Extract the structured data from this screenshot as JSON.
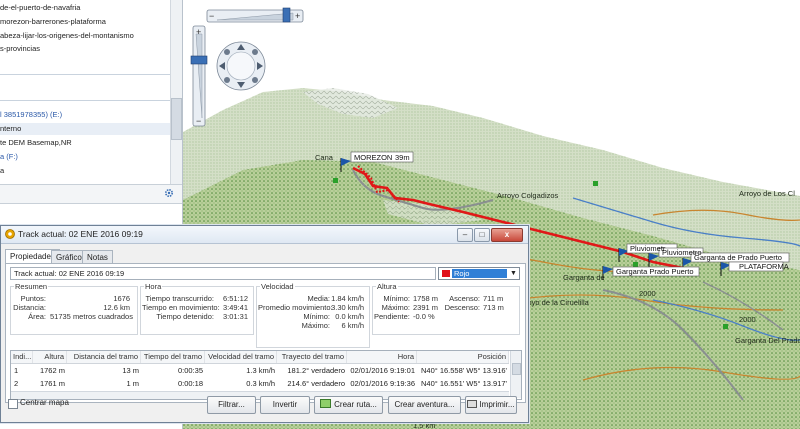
{
  "left_panel": {
    "items": [
      {
        "label": "de-el-puerto-de-navafria"
      },
      {
        "label": "morezon-barrerones-plataforma"
      },
      {
        "label": "abeza-lijar-los-origenes-del-montanismo"
      },
      {
        "label": "s-provincias"
      },
      {
        "label": "l 3851978355) (E:)"
      },
      {
        "label": "nterno"
      },
      {
        "label": "te DEM Basemap,NR"
      },
      {
        "label": "a (F:)"
      },
      {
        "label": "a"
      }
    ]
  },
  "map": {
    "labels": {
      "morezon": "MOREZON",
      "cana_prefix": "Cana",
      "morezon_height": "39m",
      "arroyo_colgadizos": "Arroyo Colgadizos",
      "arroyo_de_los": "Arroyo de Los Cl",
      "pluviometro1": "Pluviometr",
      "pluviometro2": "Pluviometro",
      "garganta_prado_puerto": "Garganta Prado Puerto",
      "garganta_de_prado_puerto": "Garganta de Prado Puerto",
      "plataforma": "PLATAFORMA",
      "garganta_de": "Garganta de",
      "arroyo_ciruelilla": "royo de la Ciruelilla",
      "garganta_del_prado": "Garganta Del Prado P",
      "contour_2000a": "2000",
      "contour_2000b": "2000",
      "bottom_fragment": "1,5 km"
    }
  },
  "dialog": {
    "title": "Track actual: 02 ENE 2016 09:19",
    "tabs": [
      "Propiedades",
      "Gráfico",
      "Notas"
    ],
    "name_value": "Track actual: 02 ENE 2016 09:19",
    "color_label": "Rojo",
    "colors": {
      "swatch": "#e0101a",
      "selection": "#2f7fd6"
    },
    "resumen": {
      "title": "Resumen",
      "rows": [
        {
          "label": "Puntos:",
          "value": "1676"
        },
        {
          "label": "Distancia:",
          "value": "12.6 km"
        },
        {
          "label": "Área:",
          "value": "51735 metros cuadrados"
        }
      ]
    },
    "hora": {
      "title": "Hora",
      "rows": [
        {
          "label": "Tiempo transcurrido:",
          "value": "6:51:12"
        },
        {
          "label": "Tiempo en movimiento:",
          "value": "3:49:41"
        },
        {
          "label": "Tiempo detenido:",
          "value": "3:01:31"
        }
      ]
    },
    "velocidad": {
      "title": "Velocidad",
      "rows": [
        {
          "label": "Media:",
          "value": "1.84 km/h"
        },
        {
          "label": "Promedio movimiento:",
          "value": "3.30 km/h"
        },
        {
          "label": "Mínimo:",
          "value": "0.0 km/h"
        },
        {
          "label": "Máximo:",
          "value": "6 km/h"
        }
      ]
    },
    "altura": {
      "title": "Altura",
      "min_label": "Mínimo:",
      "min_value": "1758 m",
      "max_label": "Máximo:",
      "max_value": "2391 m",
      "asc_label": "Ascenso:",
      "asc_value": "711 m",
      "desc_label": "Descenso:",
      "desc_value": "713 m",
      "slope_label": "Pendiente:",
      "slope_value": "-0.0 %"
    },
    "table": {
      "headers": [
        "Indi...",
        "Altura",
        "Distancia del tramo",
        "Tiempo del tramo",
        "Velocidad del tramo",
        "Trayecto del tramo",
        "Hora",
        "Posición"
      ],
      "rows": [
        [
          "1",
          "1762 m",
          "13 m",
          "0:00:35",
          "1.3 km/h",
          "181.2° verdadero",
          "02/01/2016 9:19:01",
          "N40° 16.558' W5° 13.916'"
        ],
        [
          "2",
          "1761 m",
          "1 m",
          "0:00:18",
          "0.3 km/h",
          "214.6° verdadero",
          "02/01/2016 9:19:36",
          "N40° 16.551' W5° 13.917'"
        ]
      ]
    },
    "centrar_mapa": "Centrar mapa",
    "buttons": {
      "filtrar": "Filtrar...",
      "invertir": "Invertir",
      "crear_ruta": "Crear ruta...",
      "crear_aventura": "Crear aventura...",
      "imprimir": "Imprimir..."
    }
  }
}
